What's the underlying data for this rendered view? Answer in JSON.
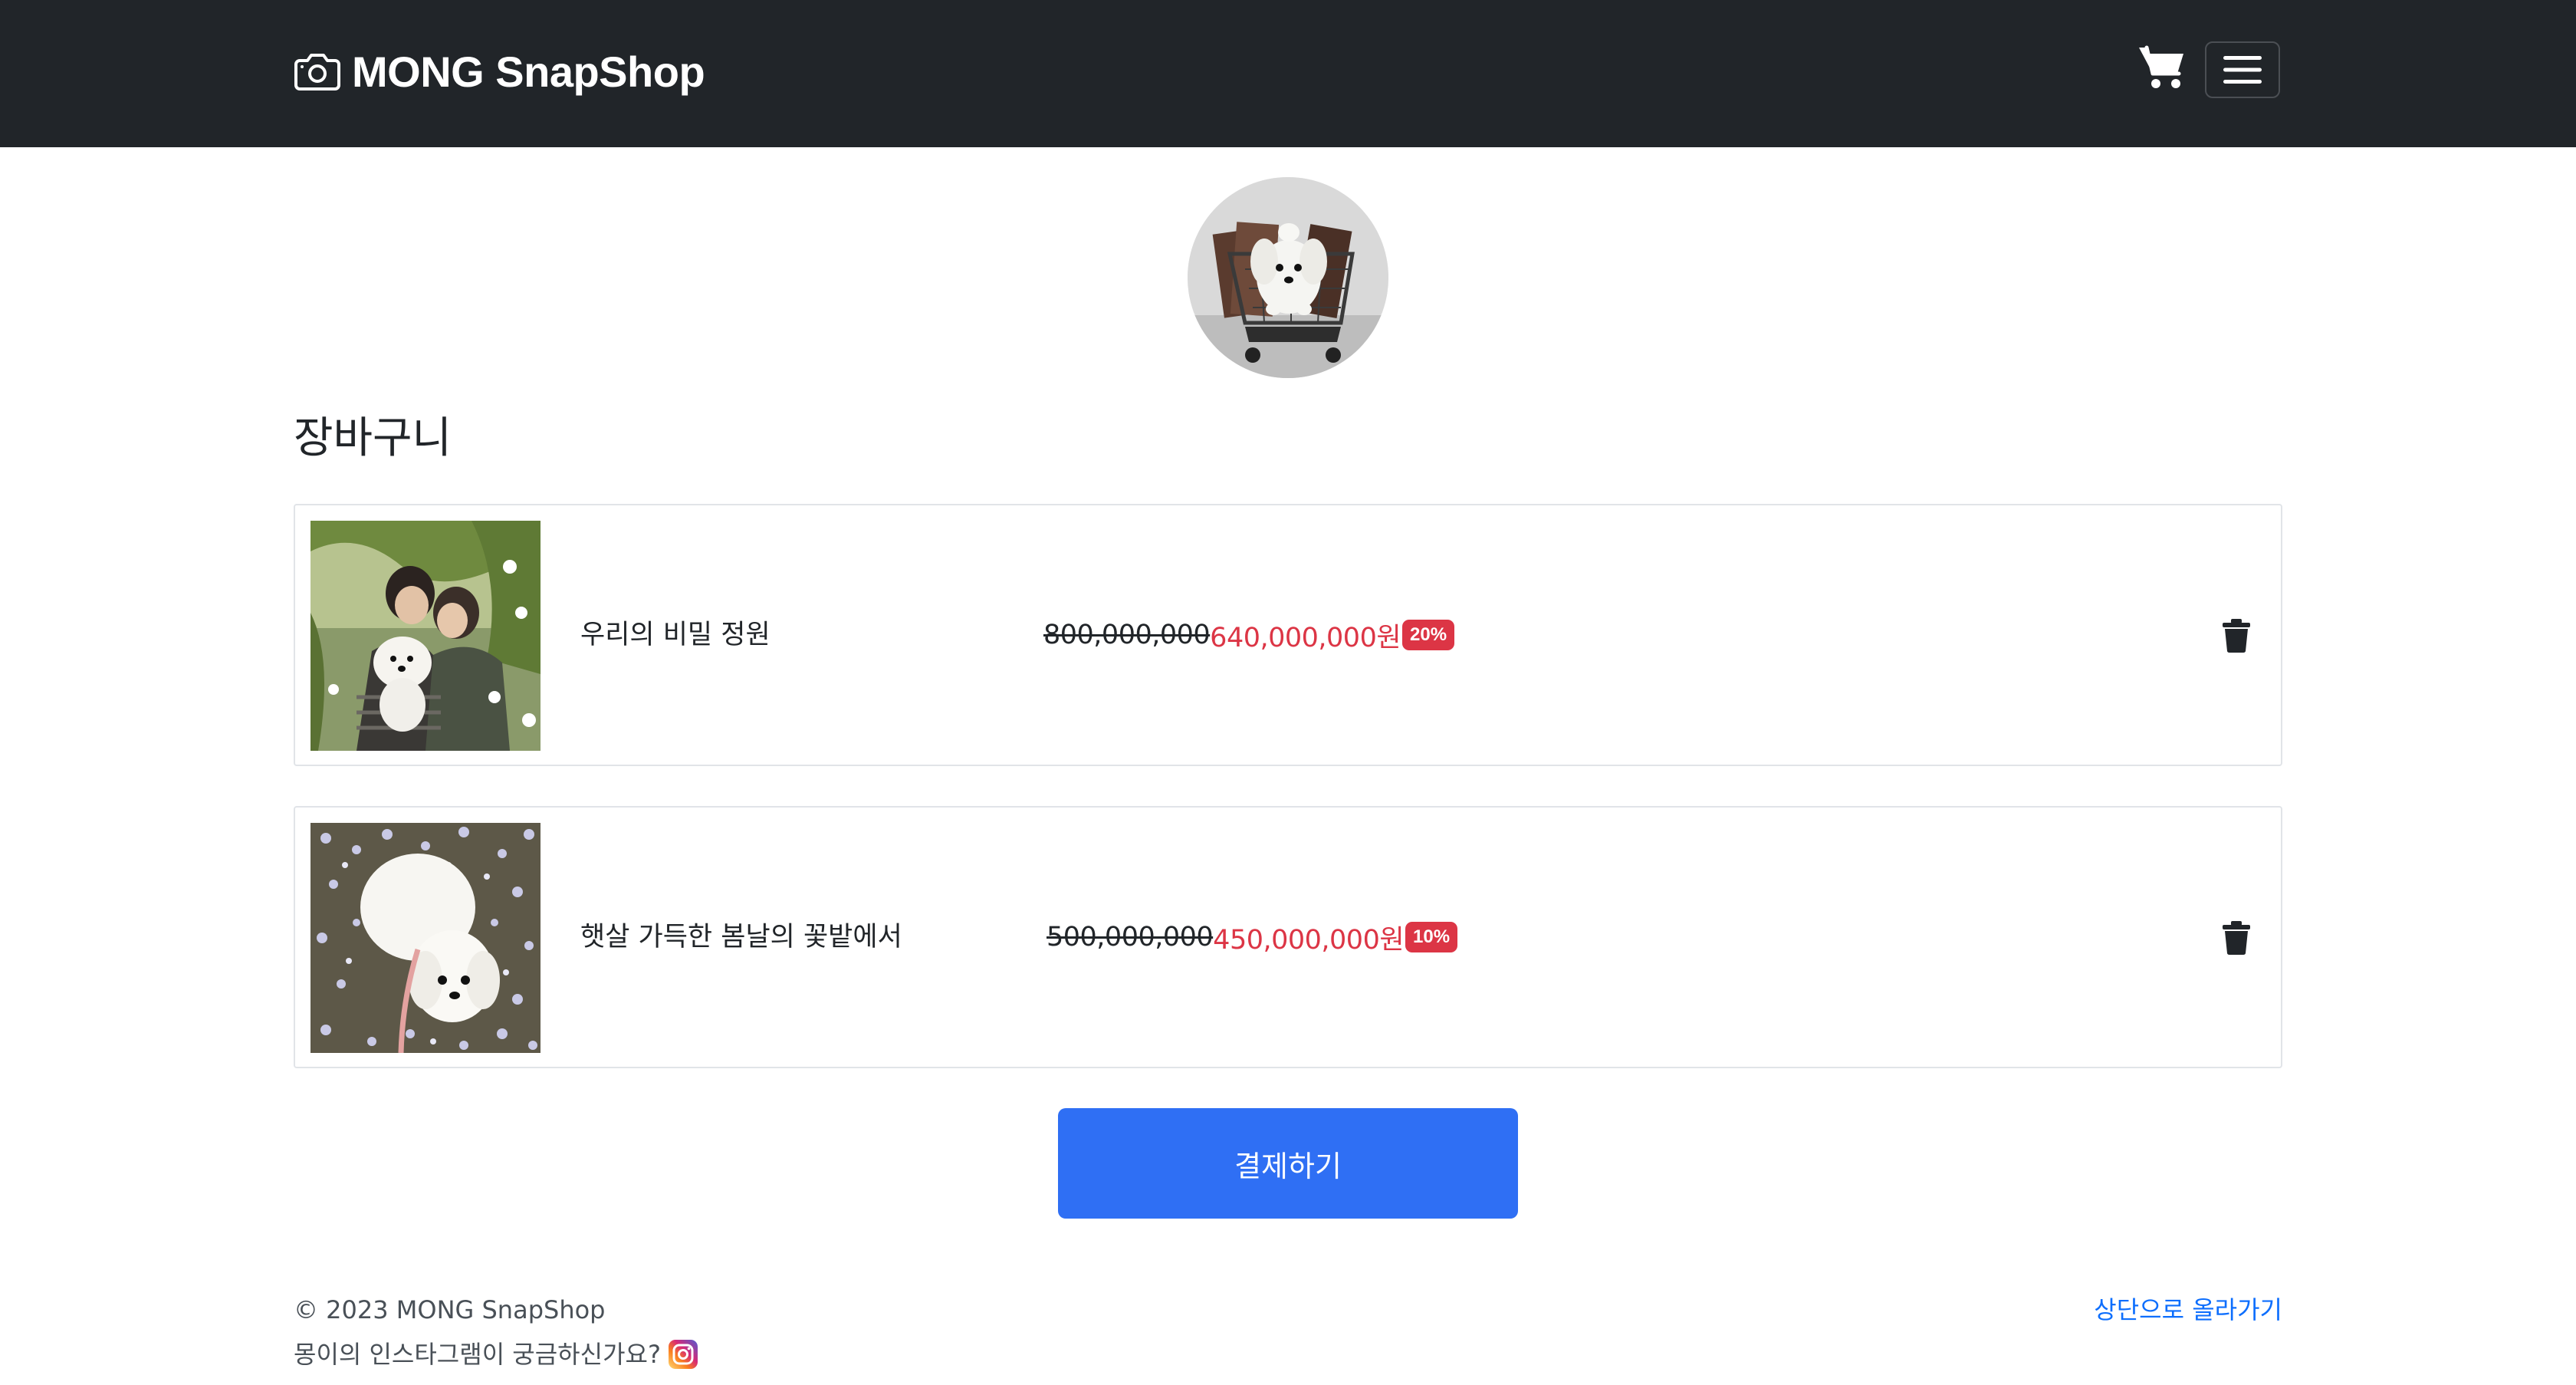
{
  "navbar": {
    "brand": "MONG SnapShop",
    "brand_icon": "camera-icon",
    "cart_icon": "cart-icon",
    "menu_icon": "hamburger-menu-icon",
    "background_color": "#212529"
  },
  "page": {
    "title": "장바구니",
    "avatar_icon": "dog-in-cart-avatar"
  },
  "cart_items": [
    {
      "title": "우리의 비밀 정원",
      "original_price": "800,000,000",
      "sale_price": "640,000,000원",
      "discount": "20%",
      "delete_icon": "trash-icon"
    },
    {
      "title": "햇살 가득한 봄날의 꽃밭에서",
      "original_price": "500,000,000",
      "sale_price": "450,000,000원",
      "discount": "10%",
      "delete_icon": "trash-icon"
    }
  ],
  "checkout": {
    "label": "결제하기",
    "color": "#2f6ff4"
  },
  "footer": {
    "copyright": "© 2023 MONG SnapShop",
    "instagram_prompt": "몽이의 인스타그램이 궁금하신가요?",
    "instagram_icon": "instagram-icon",
    "back_to_top": "상단으로 올라가기",
    "link_color": "#0d6efd"
  },
  "colors": {
    "sale": "#dc3545",
    "badge": "#dc3545"
  }
}
